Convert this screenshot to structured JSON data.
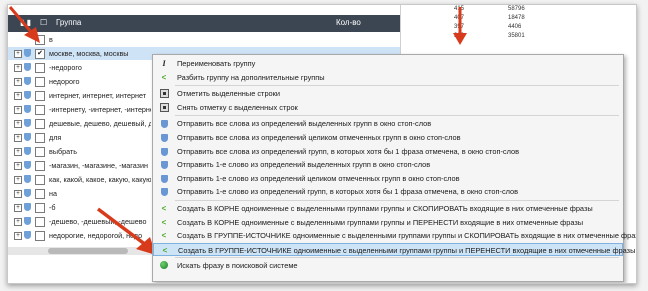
{
  "header": {
    "col_group": "Группа",
    "col_count": "Кол-во"
  },
  "filter_row": {
    "value": "в"
  },
  "rows": [
    {
      "text": "москве, москва, москвы",
      "checked": true,
      "selected": true
    },
    {
      "text": "-недорого",
      "checked": false
    },
    {
      "text": "недорого",
      "checked": false
    },
    {
      "text": "интернет, интернет, интернет",
      "checked": false
    },
    {
      "text": "-интернету, -интернет, -интернет",
      "checked": false
    },
    {
      "text": "дешевые, дешево, дешевый, д",
      "checked": false
    },
    {
      "text": "для",
      "checked": false
    },
    {
      "text": "выбрать",
      "checked": false
    },
    {
      "text": "-магазин, -магазине, -магазин",
      "checked": false
    },
    {
      "text": "как, какой, какое, какую, какую",
      "checked": false
    },
    {
      "text": "на",
      "checked": false
    },
    {
      "text": "-б",
      "checked": false
    },
    {
      "text": "-дешево, -дешевый, -дешево",
      "checked": false
    },
    {
      "text": "недорогие, недорогой, недо",
      "checked": false
    }
  ],
  "numbers": [
    [
      "415",
      "58796"
    ],
    [
      "407",
      "18478"
    ],
    [
      "397",
      "4406"
    ],
    [
      "306",
      "35801"
    ]
  ],
  "menu": {
    "items": [
      {
        "icon": "italic-icon",
        "label": "Переименовать группу"
      },
      {
        "icon": "split-chevron-icon",
        "label": "Разбить группу на дополнительные группы"
      },
      {
        "sep": true
      },
      {
        "icon": "checkbox-icon",
        "label": "Отметить выделенные строки"
      },
      {
        "icon": "checkbox-icon",
        "label": "Снять отметку с выделенных строк"
      },
      {
        "sep": true
      },
      {
        "icon": "shield-icon",
        "label": "Отправить все слова из определений выделенных групп в окно стоп-слов"
      },
      {
        "icon": "shield-icon",
        "label": "Отправить все слова из определений целиком отмеченных групп в окно стоп-слов"
      },
      {
        "icon": "shield-icon",
        "label": "Отправить все слова из определений групп, в которых хотя бы 1 фраза отмечена, в окно стоп-слов"
      },
      {
        "icon": "shield-icon",
        "label": "Отправить 1-е слово из определений выделенных групп в окно стоп-слов"
      },
      {
        "icon": "shield-icon",
        "label": "Отправить 1-е слово из определений целиком отмеченных групп в окно стоп-слов"
      },
      {
        "icon": "shield-icon",
        "label": "Отправить 1-е слово из определений групп, в которых хотя бы 1 фраза отмечена, в окно стоп-слов"
      },
      {
        "sep": true
      },
      {
        "icon": "chevron-icon",
        "label": "Создать В КОРНЕ одноименные с выделенными группами группы и СКОПИРОВАТЬ входящие в них отмеченные фразы"
      },
      {
        "icon": "chevron-icon",
        "label": "Создать В КОРНЕ одноименные с выделенными группами группы и ПЕРЕНЕСТИ входящие в них отмеченные фразы"
      },
      {
        "icon": "chevron-icon",
        "label": "Создать В ГРУППЕ-ИСТОЧНИКЕ одноименные с выделенными группами группы и СКОПИРОВАТЬ входящие в них отмеченные фразы"
      },
      {
        "icon": "chevron-icon",
        "label": "Создать В ГРУППЕ-ИСТОЧНИКЕ одноименные с выделенными группами группы и ПЕРЕНЕСТИ входящие в них отмеченные фразы",
        "highlighted": true
      },
      {
        "sep": true
      },
      {
        "icon": "globe-icon",
        "label": "Искать фразу в поисковой системе"
      }
    ]
  },
  "colors": {
    "header_bg": "#3c4653",
    "highlight": "#cde4f6",
    "arrow": "#d83a1c",
    "accent_green": "#4caa2a"
  }
}
